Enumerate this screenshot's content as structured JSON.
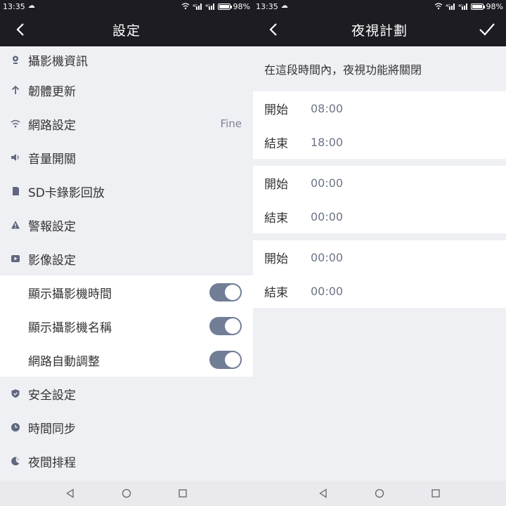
{
  "status_left": {
    "time": "13:35",
    "cloud_icon": "cloud-icon"
  },
  "status_right": {
    "wifi_icon": "wifi-icon",
    "signal1": "4G",
    "signal2": "4G",
    "battery_percent": "98%",
    "battery_level": 0.98
  },
  "left_screen": {
    "nav": {
      "title": "設定",
      "back_icon": "back-arrow-icon"
    },
    "items": [
      {
        "icon": "camera-icon",
        "label": "攝影機資訊"
      },
      {
        "icon": "upload-arrow-icon",
        "label": "韌體更新"
      },
      {
        "icon": "wifi-icon",
        "label": "網路設定",
        "value": "Fine"
      },
      {
        "icon": "speaker-icon",
        "label": "音量開關"
      },
      {
        "icon": "sd-card-icon",
        "label": "SD卡錄影回放"
      },
      {
        "icon": "warning-icon",
        "label": "警報設定"
      },
      {
        "icon": "video-icon",
        "label": "影像設定"
      }
    ],
    "toggles": [
      {
        "label": "顯示攝影機時間",
        "on": true
      },
      {
        "label": "顯示攝影機名稱",
        "on": true
      },
      {
        "label": "網路自動調整",
        "on": true
      }
    ],
    "items_after": [
      {
        "icon": "shield-icon",
        "label": "安全設定"
      },
      {
        "icon": "clock-icon",
        "label": "時間同步"
      },
      {
        "icon": "moon-icon",
        "label": "夜間排程"
      }
    ]
  },
  "right_screen": {
    "nav": {
      "title": "夜視計劃",
      "back_icon": "back-arrow-icon",
      "confirm_icon": "check-icon"
    },
    "description": "在這段時間內，夜視功能將關閉",
    "schedules": [
      {
        "start_label": "開始",
        "start": "08:00",
        "end_label": "結束",
        "end": "18:00"
      },
      {
        "start_label": "開始",
        "start": "00:00",
        "end_label": "結束",
        "end": "00:00"
      },
      {
        "start_label": "開始",
        "start": "00:00",
        "end_label": "結束",
        "end": "00:00"
      }
    ]
  },
  "bottom_nav": {
    "back": "triangle-back-icon",
    "home": "circle-home-icon",
    "recent": "square-recent-icon"
  },
  "colors": {
    "bar": "#1c1c22",
    "accent_toggle": "#727d96",
    "bg": "#eff0f4"
  }
}
